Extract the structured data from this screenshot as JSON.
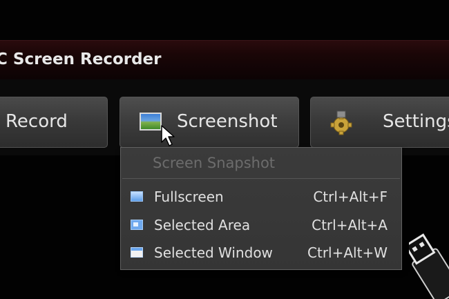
{
  "window": {
    "title": "C Screen Recorder"
  },
  "toolbar": {
    "record_label": "Record",
    "screenshot_label": "Screenshot",
    "settings_label": "Settings"
  },
  "menu": {
    "header": "Screen Snapshot",
    "items": [
      {
        "label": "Fullscreen",
        "shortcut": "Ctrl+Alt+F",
        "icon": "fullscreen-icon"
      },
      {
        "label": "Selected Area",
        "shortcut": "Ctrl+Alt+A",
        "icon": "selected-area-icon"
      },
      {
        "label": "Selected Window",
        "shortcut": "Ctrl+Alt+W",
        "icon": "selected-window-icon"
      }
    ]
  },
  "icons": {
    "screenshot": "picture-icon",
    "settings": "gear-icon",
    "cursor": "mouse-pointer-icon",
    "decoration": "usb-plug-icon"
  },
  "colors": {
    "titlebar": "#1a0607",
    "button": "#3c3c3c",
    "menu": "#383838",
    "menu_disabled_text": "#6c6c6c"
  }
}
